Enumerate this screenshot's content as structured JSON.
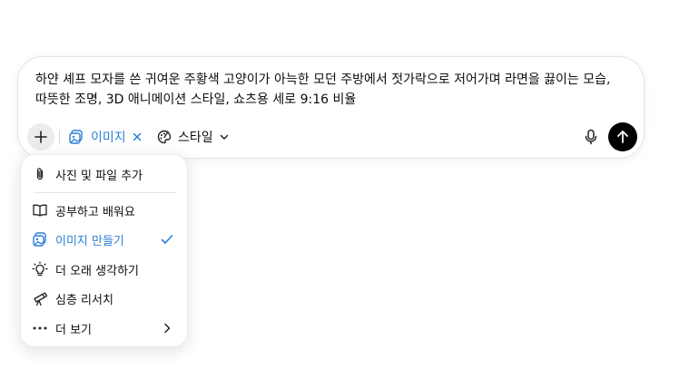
{
  "composer": {
    "prompt_text": "하얀 셰프 모자를 쓴 귀여운 주황색 고양이가 아늑한 모던 주방에서 젓가락으로 저어가며 라면을 끓이는 모습, 따뜻한 조명, 3D 애니메이션 스타일, 쇼츠용 세로 9:16 비율",
    "chips": {
      "image_label": "이미지",
      "style_label": "스타일"
    }
  },
  "menu": {
    "items": [
      {
        "label": "사진 및 파일 추가",
        "icon": "paperclip-icon"
      },
      {
        "label": "공부하고 배워요",
        "icon": "book-icon"
      },
      {
        "label": "이미지 만들기",
        "icon": "image-icon",
        "selected": true
      },
      {
        "label": "더 오래 생각하기",
        "icon": "lightbulb-icon"
      },
      {
        "label": "심층 리서치",
        "icon": "telescope-icon"
      },
      {
        "label": "더 보기",
        "icon": "more-icon"
      }
    ]
  },
  "colors": {
    "accent": "#2b7fd6",
    "send_button": "#000000",
    "plus_button_bg": "#ececec"
  }
}
